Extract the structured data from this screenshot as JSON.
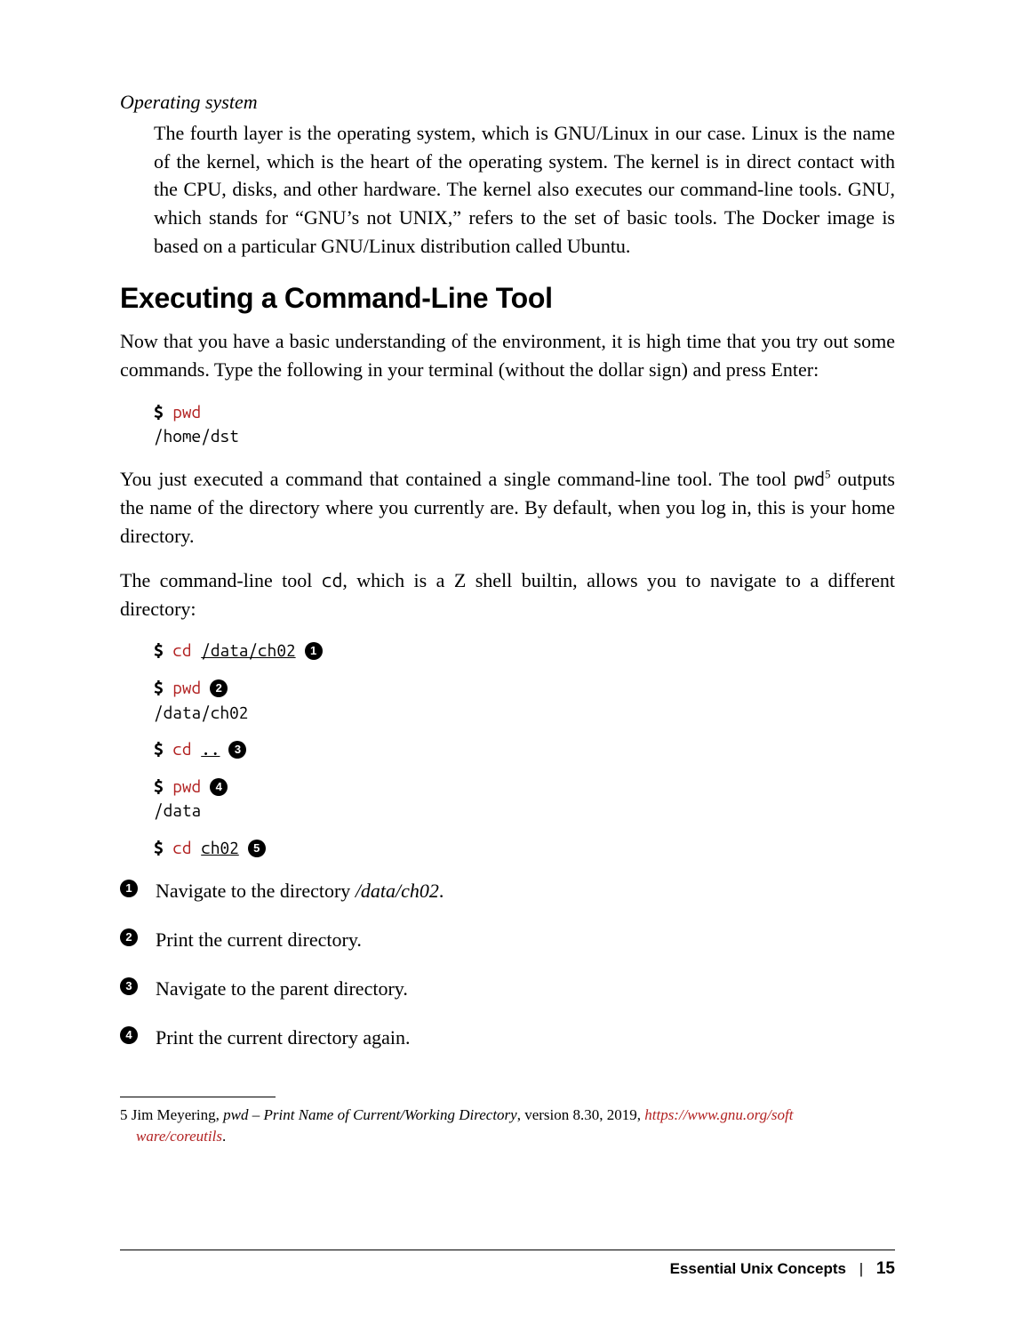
{
  "dl": {
    "term": "Operating system",
    "def": "The fourth layer is the operating system, which is GNU/Linux in our case. Linux is the name of the kernel, which is the heart of the operating system. The kernel is in direct contact with the CPU, disks, and other hardware. The kernel also executes our command-line tools. GNU, which stands for “GNU’s not UNIX,” refers to the set of basic tools. The Docker image is based on a particular GNU/Linux distribution called Ubuntu."
  },
  "heading": "Executing a Command-Line Tool",
  "para1": "Now that you have a basic understanding of the environment, it is high time that you try out some commands. Type the following in your terminal (without the dollar sign) and press Enter:",
  "code1": {
    "prompt": "$ ",
    "cmd": "pwd",
    "out": "/home/dst"
  },
  "para2_pre": "You just executed a command that contained a single command-line tool. The tool ",
  "para2_code": "pwd",
  "para2_sup": "5",
  "para2_post": " outputs the name of the directory where you currently are. By default, when you log in, this is your home directory.",
  "para3_pre": "The command-line tool ",
  "para3_code": "cd",
  "para3_post": ", which is a Z shell builtin, allows you to navigate to a different directory:",
  "code2": {
    "l1": {
      "prompt": "$ ",
      "cmd": "cd ",
      "arg": "/data/ch02",
      "co": "1"
    },
    "l2": {
      "prompt": "$ ",
      "cmd": "pwd",
      "co": "2"
    },
    "l2out": "/data/ch02",
    "l3": {
      "prompt": "$ ",
      "cmd": "cd ",
      "arg": "..",
      "co": "3"
    },
    "l4": {
      "prompt": "$ ",
      "cmd": "pwd",
      "co": "4"
    },
    "l4out": "/data",
    "l5": {
      "prompt": "$ ",
      "cmd": "cd ",
      "arg": "ch02",
      "co": "5"
    }
  },
  "colist": {
    "i1_pre": "Navigate to the directory ",
    "i1_it": "/data/ch02",
    "i1_post": ".",
    "i2": "Print the current directory.",
    "i3": "Navigate to the parent directory.",
    "i4": "Print the current directory again."
  },
  "footnote": {
    "num": "5",
    "author_pre": " Jim Meyering, ",
    "title": "pwd – Print Name of Current/Working Directory",
    "meta": ", version 8.30, 2019, ",
    "link1": "https://www.gnu.org/soft",
    "link2": "ware/coreutils",
    "period": "."
  },
  "footer": {
    "section": "Essential Unix Concepts",
    "sep": "|",
    "page": "15"
  }
}
